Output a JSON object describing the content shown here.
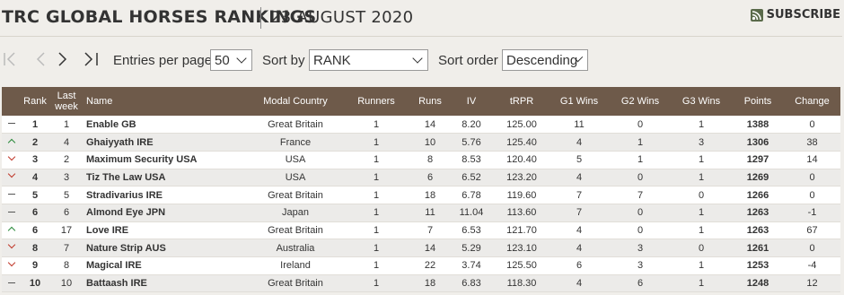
{
  "header": {
    "title": "TRC GLOBAL HORSES RANKINGS",
    "date": "23 AUGUST 2020",
    "subscribe_label": "SUBSCRIBE"
  },
  "controls": {
    "entries_label": "Entries per page",
    "entries_value": "50",
    "sort_by_label": "Sort by",
    "sort_by_value": "RANK",
    "sort_order_label": "Sort order",
    "sort_order_value": "Descending"
  },
  "table": {
    "columns": [
      "Rank",
      "Last week",
      "Name",
      "Modal Country",
      "Runners",
      "Runs",
      "IV",
      "tRPR",
      "G1 Wins",
      "G2 Wins",
      "G3 Wins",
      "Points",
      "Change"
    ],
    "rows": [
      {
        "trend": "flat",
        "rank": "1",
        "last": "1",
        "name": "Enable GB",
        "country": "Great Britain",
        "runners": "1",
        "runs": "14",
        "iv": "8.20",
        "trpr": "125.00",
        "g1": "11",
        "g2": "0",
        "g3": "1",
        "points": "1388",
        "change": "0"
      },
      {
        "trend": "up",
        "rank": "2",
        "last": "4",
        "name": "Ghaiyyath IRE",
        "country": "France",
        "runners": "1",
        "runs": "10",
        "iv": "5.76",
        "trpr": "125.40",
        "g1": "4",
        "g2": "1",
        "g3": "3",
        "points": "1306",
        "change": "38"
      },
      {
        "trend": "down",
        "rank": "3",
        "last": "2",
        "name": "Maximum Security USA",
        "country": "USA",
        "runners": "1",
        "runs": "8",
        "iv": "8.53",
        "trpr": "120.40",
        "g1": "5",
        "g2": "1",
        "g3": "1",
        "points": "1297",
        "change": "14"
      },
      {
        "trend": "down",
        "rank": "4",
        "last": "3",
        "name": "Tiz The Law USA",
        "country": "USA",
        "runners": "1",
        "runs": "6",
        "iv": "6.52",
        "trpr": "123.20",
        "g1": "4",
        "g2": "0",
        "g3": "1",
        "points": "1269",
        "change": "0"
      },
      {
        "trend": "flat",
        "rank": "5",
        "last": "5",
        "name": "Stradivarius IRE",
        "country": "Great Britain",
        "runners": "1",
        "runs": "18",
        "iv": "6.78",
        "trpr": "119.60",
        "g1": "7",
        "g2": "7",
        "g3": "0",
        "points": "1266",
        "change": "0"
      },
      {
        "trend": "flat",
        "rank": "6",
        "last": "6",
        "name": "Almond Eye JPN",
        "country": "Japan",
        "runners": "1",
        "runs": "11",
        "iv": "11.04",
        "trpr": "113.60",
        "g1": "7",
        "g2": "0",
        "g3": "1",
        "points": "1263",
        "change": "-1"
      },
      {
        "trend": "up",
        "rank": "6",
        "last": "17",
        "name": "Love IRE",
        "country": "Great Britain",
        "runners": "1",
        "runs": "7",
        "iv": "6.53",
        "trpr": "121.70",
        "g1": "4",
        "g2": "0",
        "g3": "1",
        "points": "1263",
        "change": "67"
      },
      {
        "trend": "down",
        "rank": "8",
        "last": "7",
        "name": "Nature Strip AUS",
        "country": "Australia",
        "runners": "1",
        "runs": "14",
        "iv": "5.29",
        "trpr": "123.10",
        "g1": "4",
        "g2": "3",
        "g3": "0",
        "points": "1261",
        "change": "0"
      },
      {
        "trend": "down",
        "rank": "9",
        "last": "8",
        "name": "Magical IRE",
        "country": "Ireland",
        "runners": "1",
        "runs": "22",
        "iv": "3.74",
        "trpr": "125.50",
        "g1": "6",
        "g2": "3",
        "g3": "1",
        "points": "1253",
        "change": "-4"
      },
      {
        "trend": "flat",
        "rank": "10",
        "last": "10",
        "name": "Battaash IRE",
        "country": "Great Britain",
        "runners": "1",
        "runs": "18",
        "iv": "6.83",
        "trpr": "118.30",
        "g1": "4",
        "g2": "6",
        "g3": "1",
        "points": "1248",
        "change": "12"
      }
    ]
  }
}
